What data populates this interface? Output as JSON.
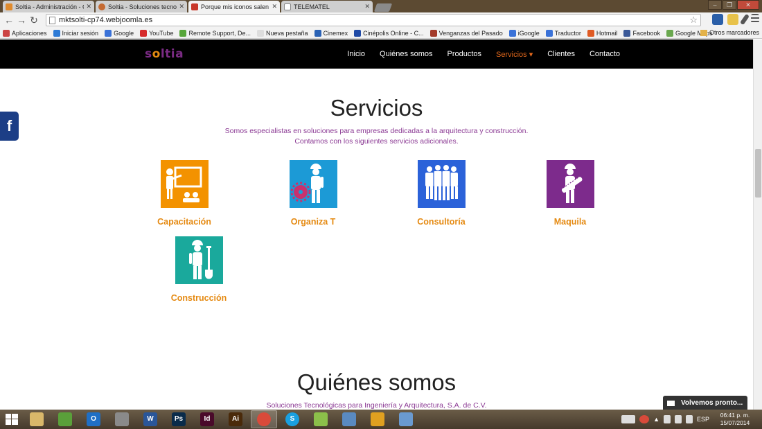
{
  "browser": {
    "tabs": [
      {
        "title": "Soltia - Administración - C",
        "fav_color": "#e08b2d"
      },
      {
        "title": "Soltia - Soluciones tecnol",
        "fav_color": "#c56b33"
      },
      {
        "title": "Porque mis iconos salen a",
        "fav_color": "#c8372a"
      },
      {
        "title": "TELEMATEL",
        "fav_color": "#ffffff"
      }
    ],
    "active_tab_index": 2,
    "url": "mktsolti-cp74.webjoomla.es",
    "bookmarks": [
      {
        "label": "Aplicaciones",
        "color": "#c44"
      },
      {
        "label": "Iniciar sesión",
        "color": "#2e7bd6"
      },
      {
        "label": "Google",
        "color": "#3a72d8"
      },
      {
        "label": "YouTube",
        "color": "#d62a2a"
      },
      {
        "label": "Remote Support, De...",
        "color": "#57a63a"
      },
      {
        "label": "Nueva pestaña",
        "color": "#dddddd"
      },
      {
        "label": "Cinemex",
        "color": "#2a62b5"
      },
      {
        "label": "Cinépolis Online - C...",
        "color": "#1f4aa6"
      },
      {
        "label": "Venganzas del Pasado",
        "color": "#a33a2a"
      },
      {
        "label": "iGoogle",
        "color": "#3a72d8"
      },
      {
        "label": "Traductor",
        "color": "#3a72d8"
      },
      {
        "label": "Hotmail",
        "color": "#e05b24"
      },
      {
        "label": "Facebook",
        "color": "#3b5998"
      },
      {
        "label": "Google Maps",
        "color": "#6aa84f"
      }
    ],
    "other_bookmarks": "Otros marcadores"
  },
  "site": {
    "logo_pre": "s",
    "logo_o": "o",
    "logo_post": "ltia",
    "menu": [
      "Inicio",
      "Quiénes somos",
      "Productos",
      "Servicios ▾",
      "Clientes",
      "Contacto"
    ],
    "active_menu": "Servicios",
    "facebook_glyph": "f",
    "section_title": "Servicios",
    "section_sub1": "Somos especialistas en soluciones para empresas dedicadas a la arquitectura y construcción.",
    "section_sub2": "Contamos con los siguientes servicios adicionales.",
    "services": [
      {
        "label": "Capacitación",
        "color": "#f39200"
      },
      {
        "label": "Organiza T",
        "color": "#1c9ad6"
      },
      {
        "label": "Consultoría",
        "color": "#2b62d9"
      },
      {
        "label": "Maquila",
        "color": "#7d2b8c"
      },
      {
        "label": "Construcción",
        "color": "#1aa99c"
      }
    ],
    "label_color": "#e58a12",
    "about_title": "Quiénes somos",
    "about_sub": "Soluciones Tecnológicas para Ingeniería y Arquitectura, S.A. de C.V.",
    "notification": "Volvemos pronto..."
  },
  "taskbar": {
    "apps": [
      {
        "name": "explorer",
        "label": "",
        "color": "#d9b86a"
      },
      {
        "name": "metro",
        "label": "",
        "color": "#5aa03a"
      },
      {
        "name": "outlook",
        "label": "O",
        "color": "#1f6fc5"
      },
      {
        "name": "tool",
        "label": "",
        "color": "#8a8a8a"
      },
      {
        "name": "word",
        "label": "W",
        "color": "#2a5699"
      },
      {
        "name": "photoshop",
        "label": "Ps",
        "color": "#0a2b4a"
      },
      {
        "name": "indesign",
        "label": "Id",
        "color": "#4a0a2a"
      },
      {
        "name": "illustrator",
        "label": "Ai",
        "color": "#4a2a0a"
      },
      {
        "name": "chrome",
        "label": "",
        "color": "#d94a3a"
      },
      {
        "name": "skype",
        "label": "S",
        "color": "#1aa0e0"
      },
      {
        "name": "notes",
        "label": "",
        "color": "#8cc04a"
      },
      {
        "name": "photos",
        "label": "",
        "color": "#5a8ac0"
      },
      {
        "name": "media",
        "label": "",
        "color": "#e0a020"
      },
      {
        "name": "misc",
        "label": "",
        "color": "#6a9ad0"
      }
    ],
    "active_app_index": 8,
    "language": "ESP",
    "time": "06:41 p. m.",
    "date": "15/07/2014"
  }
}
